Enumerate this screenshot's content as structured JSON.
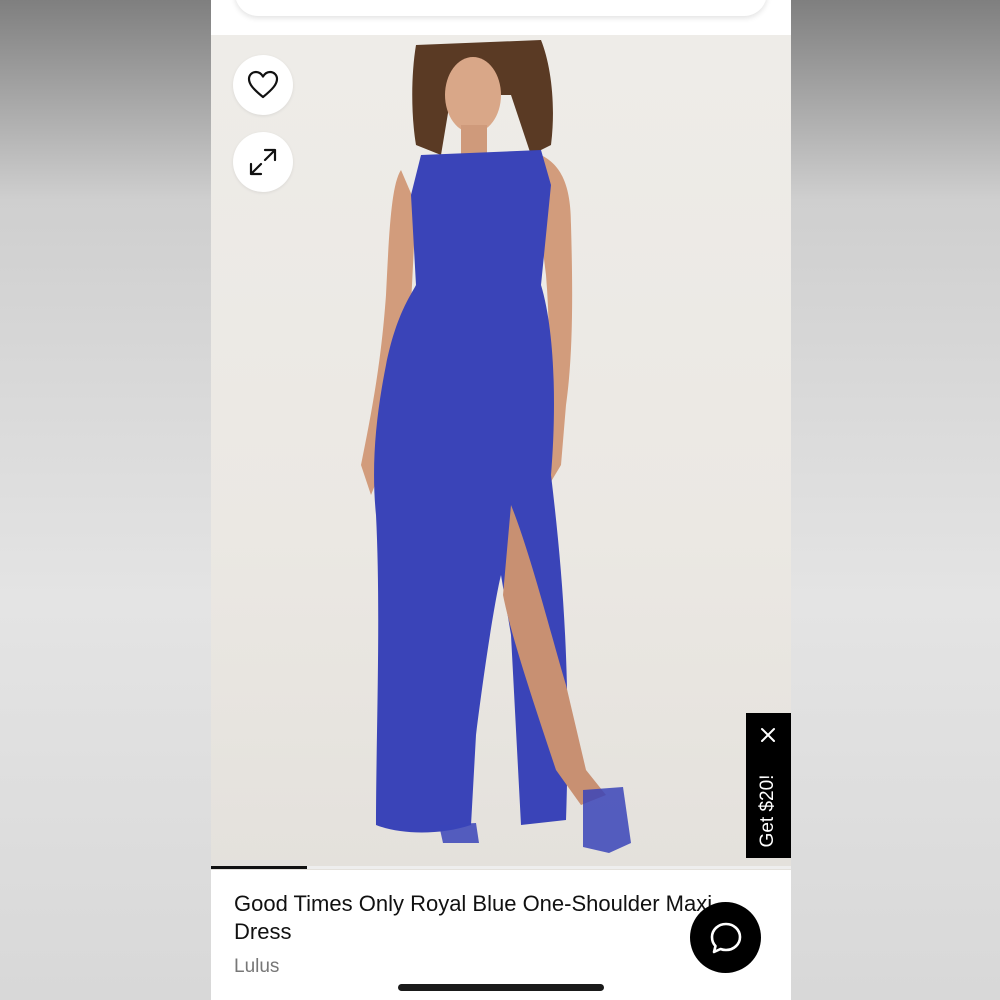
{
  "product": {
    "title": "Good Times Only Royal Blue One-Shoulder Maxi Dress",
    "brand": "Lulus",
    "dress_color": "#3a44b8"
  },
  "gallery": {
    "progress": 0.165,
    "favorite_icon": "heart-icon",
    "expand_icon": "expand-icon"
  },
  "promo": {
    "label": "Get $20!",
    "close_icon": "close-icon"
  },
  "chat": {
    "icon": "chat-bubble-icon"
  },
  "colors": {
    "background": "#ffffff",
    "text": "#111111",
    "muted": "#777777",
    "accent": "#000000"
  }
}
